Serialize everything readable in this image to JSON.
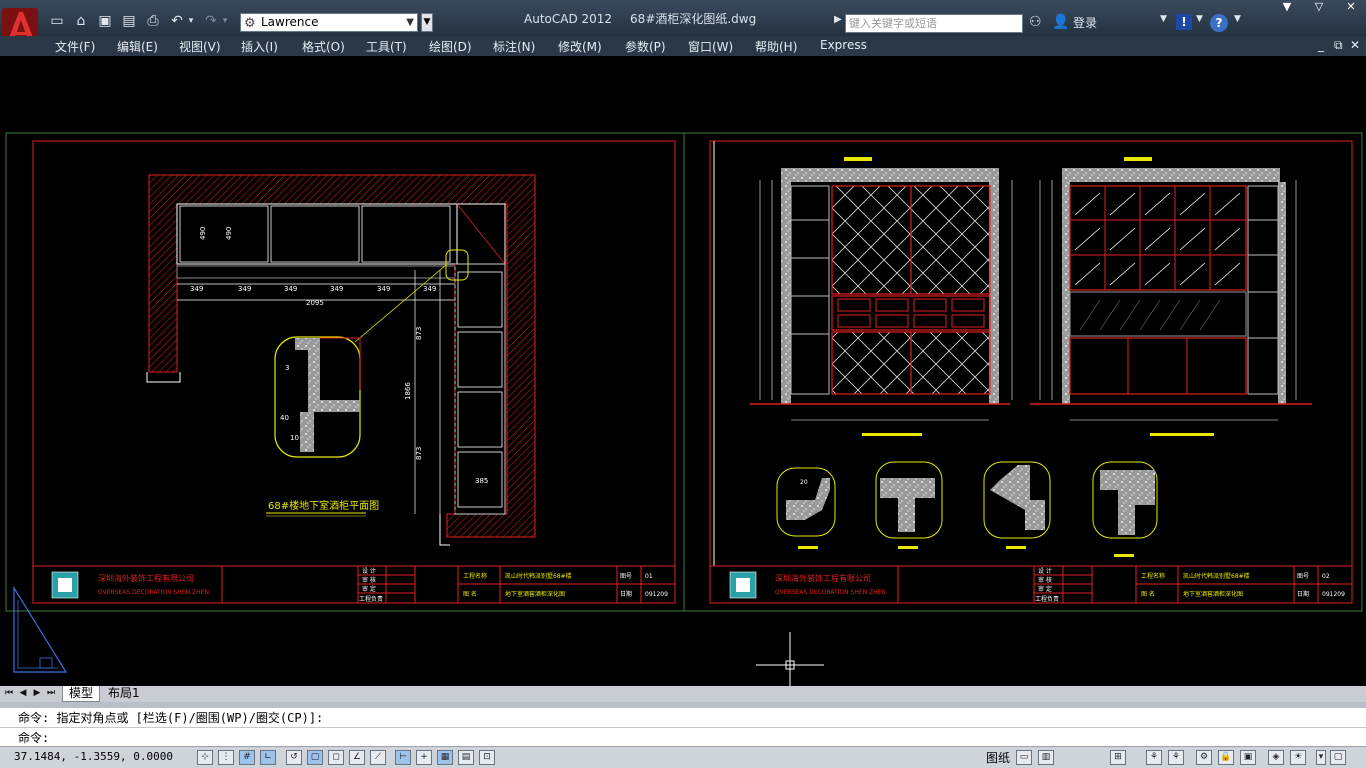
{
  "app": {
    "name": "AutoCAD 2012",
    "filename": "68#酒柜深化图纸.dwg"
  },
  "quickaccess": {
    "workspace": "Lawrence"
  },
  "search": {
    "placeholder": "键入关键字或短语"
  },
  "account": {
    "login": "登录"
  },
  "menus": [
    "文件(F)",
    "编辑(E)",
    "视图(V)",
    "插入(I)",
    "格式(O)",
    "工具(T)",
    "绘图(D)",
    "标注(N)",
    "修改(M)",
    "参数(P)",
    "窗口(W)",
    "帮助(H)",
    "Express"
  ],
  "drawing": {
    "plan_title": "68#楼地下室酒柜平面图",
    "company_cn": "深圳海外装饰工程有限公司",
    "company_en": "OVERSEAS DECORATION SHEN ZHEN",
    "dims_row": [
      "349",
      "349",
      "349",
      "349",
      "349",
      "349"
    ],
    "dim_total": "2095",
    "dim_490a": "490",
    "dim_490b": "490",
    "dim_873a": "873",
    "dim_873b": "873",
    "dim_1866": "1866",
    "dim_385": "385",
    "detail_3": "3",
    "detail_40": "40",
    "detail_10": "10",
    "detail_20": "20",
    "sheet1": {
      "project_label": "工程名称",
      "project": "凯山时代韩派别墅68#楼",
      "drawing_label": "图 名",
      "drawing_name": "地下室酒窖酒柜深化图",
      "no_label": "图号",
      "no": "01",
      "date_label": "日期",
      "date": "091209",
      "roles": [
        "设 计",
        "审 核",
        "审 定",
        "工程负责"
      ]
    },
    "sheet2": {
      "project_label": "工程名称",
      "project": "凯山时代韩派别墅68#楼",
      "drawing_label": "图 名",
      "drawing_name": "地下室酒窖酒柜深化图",
      "no_label": "图号",
      "no": "02",
      "date_label": "日期",
      "date": "091209",
      "roles": [
        "设 计",
        "审 核",
        "审 定",
        "工程负责"
      ]
    }
  },
  "tabs": {
    "model": "模型",
    "layout1": "布局1"
  },
  "command": {
    "history": "命令: 指定对角点或 [栏选(F)/圈围(WP)/圈交(CP)]:",
    "prompt": "命令:"
  },
  "status": {
    "coords": "37.1484, -1.3559, 0.0000",
    "paper": "图纸"
  }
}
